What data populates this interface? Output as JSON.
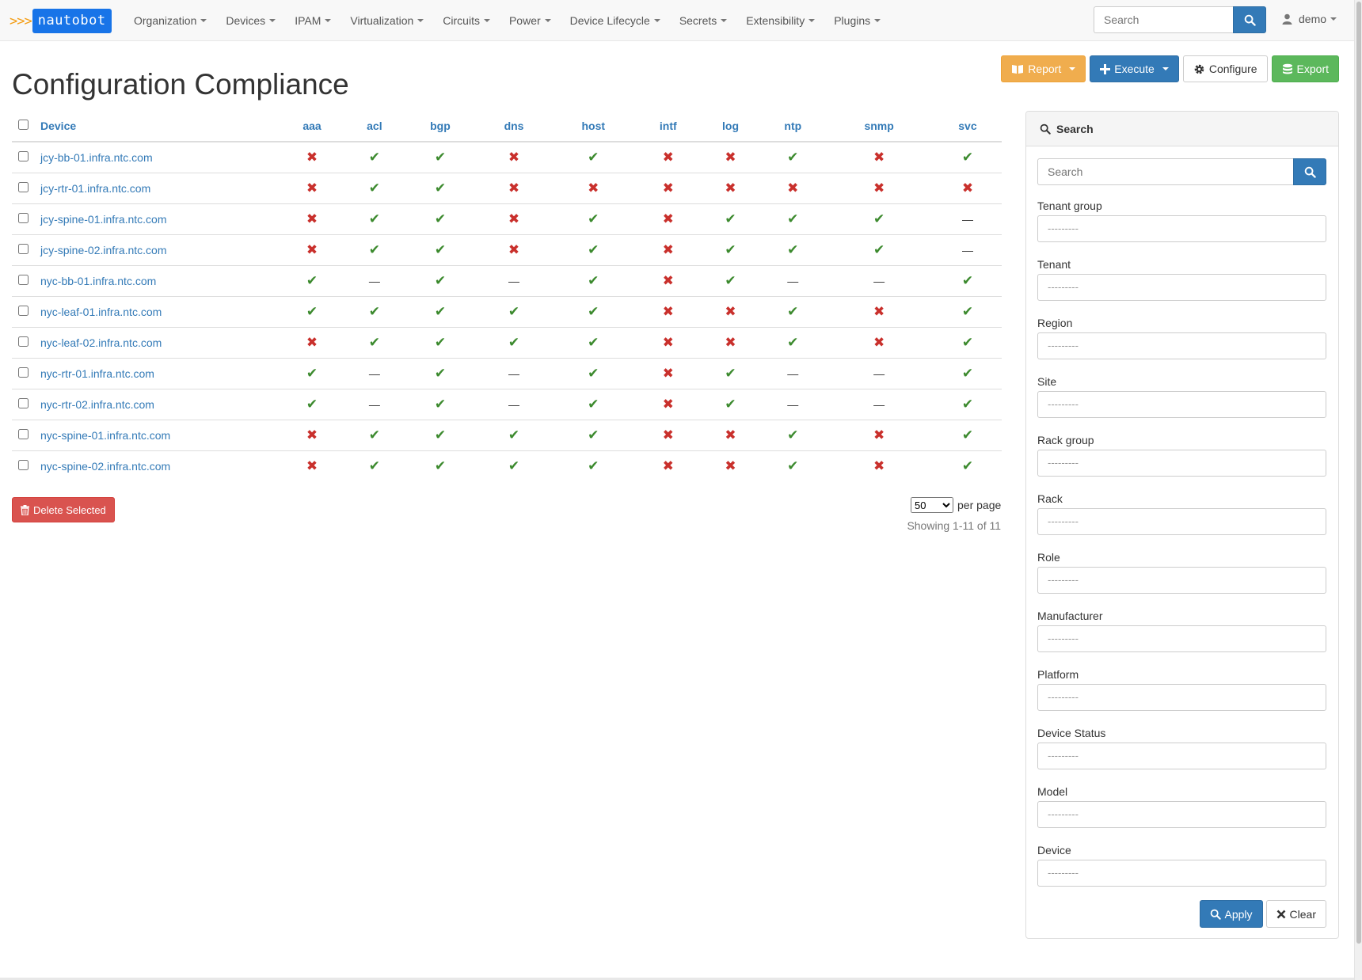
{
  "nav": {
    "brand_arrows": ">>>",
    "brand_name": "nautobot",
    "menu": [
      "Organization",
      "Devices",
      "IPAM",
      "Virtualization",
      "Circuits",
      "Power",
      "Device Lifecycle",
      "Secrets",
      "Extensibility",
      "Plugins"
    ],
    "search_placeholder": "Search",
    "user": "demo"
  },
  "page": {
    "title": "Configuration Compliance",
    "actions": {
      "report": "Report",
      "execute": "Execute",
      "configure": "Configure",
      "export": "Export"
    }
  },
  "colors": {
    "ok": "#3c8a2e",
    "fail": "#c9302c",
    "link": "#337ab7",
    "navbar": "#f8f8f8"
  },
  "table": {
    "device_header": "Device",
    "features": [
      "aaa",
      "acl",
      "bgp",
      "dns",
      "host",
      "intf",
      "log",
      "ntp",
      "snmp",
      "svc"
    ],
    "rows": [
      {
        "device": "jcy-bb-01.infra.ntc.com",
        "status": [
          "fail",
          "ok",
          "ok",
          "fail",
          "ok",
          "fail",
          "fail",
          "ok",
          "fail",
          "ok"
        ]
      },
      {
        "device": "jcy-rtr-01.infra.ntc.com",
        "status": [
          "fail",
          "ok",
          "ok",
          "fail",
          "fail",
          "fail",
          "fail",
          "fail",
          "fail",
          "fail"
        ]
      },
      {
        "device": "jcy-spine-01.infra.ntc.com",
        "status": [
          "fail",
          "ok",
          "ok",
          "fail",
          "ok",
          "fail",
          "ok",
          "ok",
          "ok",
          "na"
        ]
      },
      {
        "device": "jcy-spine-02.infra.ntc.com",
        "status": [
          "fail",
          "ok",
          "ok",
          "fail",
          "ok",
          "fail",
          "ok",
          "ok",
          "ok",
          "na"
        ]
      },
      {
        "device": "nyc-bb-01.infra.ntc.com",
        "status": [
          "ok",
          "na",
          "ok",
          "na",
          "ok",
          "fail",
          "ok",
          "na",
          "na",
          "ok"
        ]
      },
      {
        "device": "nyc-leaf-01.infra.ntc.com",
        "status": [
          "ok",
          "ok",
          "ok",
          "ok",
          "ok",
          "fail",
          "fail",
          "ok",
          "fail",
          "ok"
        ]
      },
      {
        "device": "nyc-leaf-02.infra.ntc.com",
        "status": [
          "fail",
          "ok",
          "ok",
          "ok",
          "ok",
          "fail",
          "fail",
          "ok",
          "fail",
          "ok"
        ]
      },
      {
        "device": "nyc-rtr-01.infra.ntc.com",
        "status": [
          "ok",
          "na",
          "ok",
          "na",
          "ok",
          "fail",
          "ok",
          "na",
          "na",
          "ok"
        ]
      },
      {
        "device": "nyc-rtr-02.infra.ntc.com",
        "status": [
          "ok",
          "na",
          "ok",
          "na",
          "ok",
          "fail",
          "ok",
          "na",
          "na",
          "ok"
        ]
      },
      {
        "device": "nyc-spine-01.infra.ntc.com",
        "status": [
          "fail",
          "ok",
          "ok",
          "ok",
          "ok",
          "fail",
          "fail",
          "ok",
          "fail",
          "ok"
        ]
      },
      {
        "device": "nyc-spine-02.infra.ntc.com",
        "status": [
          "fail",
          "ok",
          "ok",
          "ok",
          "ok",
          "fail",
          "fail",
          "ok",
          "fail",
          "ok"
        ]
      }
    ]
  },
  "footer": {
    "delete_label": "Delete Selected",
    "per_page_value": "50",
    "per_page_label": "per page",
    "showing": "Showing 1-11 of 11"
  },
  "sidebar": {
    "heading": "Search",
    "search_placeholder": "Search",
    "filters": [
      {
        "label": "Tenant group",
        "placeholder": "---------"
      },
      {
        "label": "Tenant",
        "placeholder": "---------"
      },
      {
        "label": "Region",
        "placeholder": "---------"
      },
      {
        "label": "Site",
        "placeholder": "---------"
      },
      {
        "label": "Rack group",
        "placeholder": "---------"
      },
      {
        "label": "Rack",
        "placeholder": "---------"
      },
      {
        "label": "Role",
        "placeholder": "---------"
      },
      {
        "label": "Manufacturer",
        "placeholder": "---------"
      },
      {
        "label": "Platform",
        "placeholder": "---------"
      },
      {
        "label": "Device Status",
        "placeholder": "---------"
      },
      {
        "label": "Model",
        "placeholder": "---------"
      },
      {
        "label": "Device",
        "placeholder": "---------"
      }
    ],
    "apply_label": "Apply",
    "clear_label": "Clear"
  }
}
